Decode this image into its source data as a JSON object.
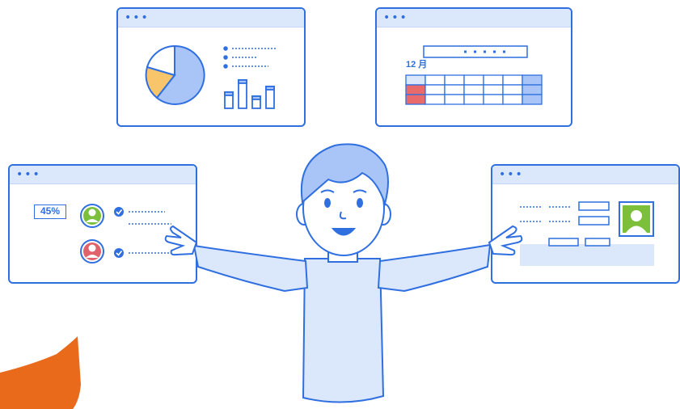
{
  "windows": {
    "chart": {
      "title_dots": "•••"
    },
    "calendar": {
      "title_dots": "•••",
      "month_label": "12 月"
    },
    "stats": {
      "title_dots": "•••",
      "percent_label": "45%"
    },
    "profile": {
      "title_dots": "•••"
    }
  },
  "icons": {
    "pie": "pie-chart-icon",
    "bars": "bar-chart-icon",
    "check": "check-circle-icon",
    "avatar": "avatar-icon"
  },
  "colors": {
    "outline": "#2f6fe0",
    "fill_light": "#dbe7fb",
    "pie_blue": "#a9c5f7",
    "pie_yellow": "#f9c56b",
    "calendar_red": "#e86a6a",
    "avatar_green": "#7bbf3b",
    "avatar_red": "#e0626a",
    "orange_blob": "#ea6a1c"
  }
}
